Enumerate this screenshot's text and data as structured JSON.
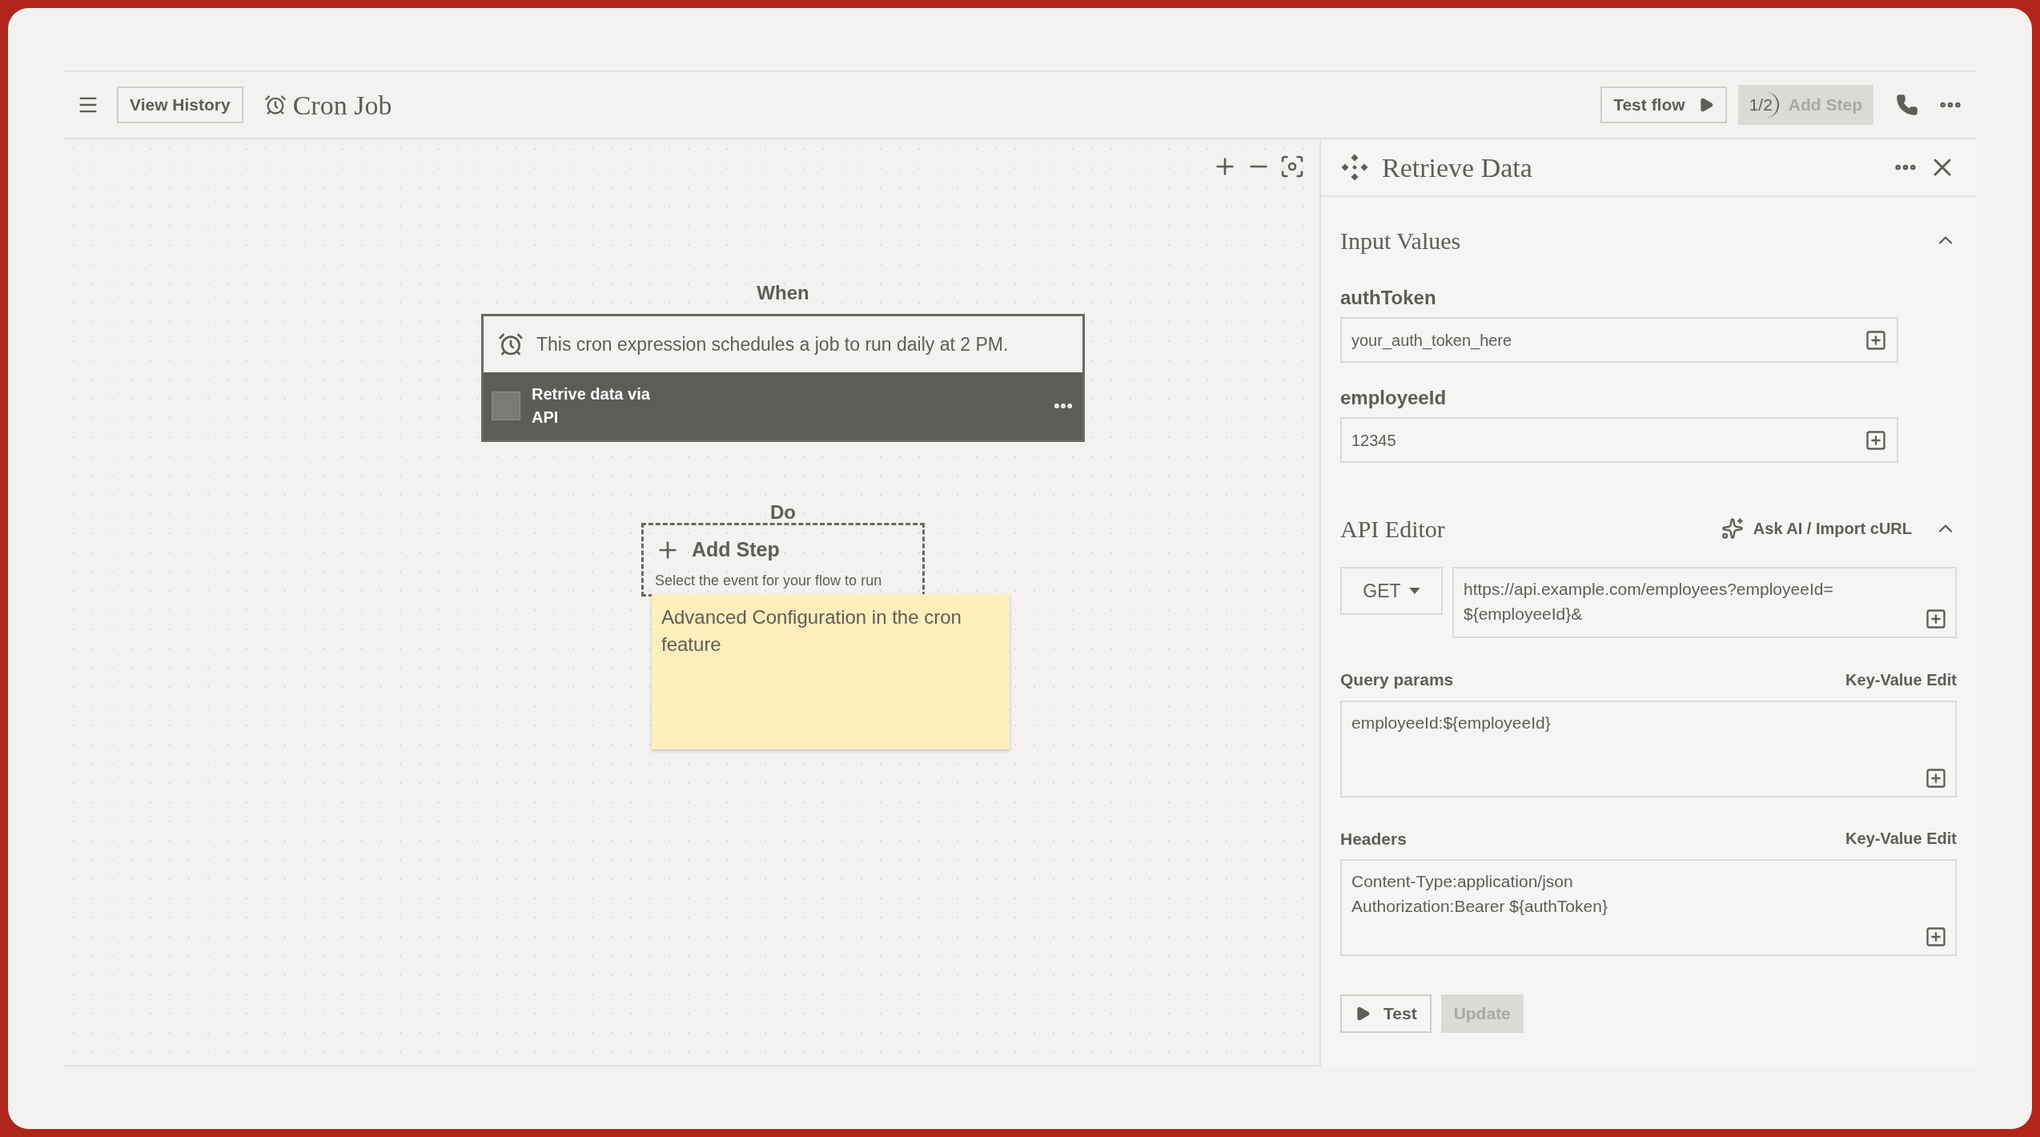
{
  "toolbar": {
    "history_button": "View History",
    "title": "Cron Job",
    "test_button": "Test flow",
    "step_counter": "1/2",
    "add_step_button": {
      "label": "Add Step",
      "disabled": true
    }
  },
  "canvas": {
    "trigger": {
      "section_label": "When",
      "description": "This cron expression schedules a job to run daily at 2 PM.",
      "step_title": "Retrive data via API"
    },
    "action": {
      "section_label": "Do",
      "add_step": "Add Step",
      "hint": "Select the event for your flow to run"
    },
    "note": "Advanced Configuration in the cron feature"
  },
  "panel": {
    "title": "Retrieve Data",
    "input_values": {
      "title": "Input Values",
      "expanded": true,
      "fields": [
        {
          "label": "authToken",
          "value": "your_auth_token_here"
        },
        {
          "label": "employeeId",
          "value": "12345"
        }
      ]
    },
    "api_editor": {
      "title": "API Editor",
      "expanded": true,
      "ai_link": "Ask AI / Import cURL",
      "method": "GET",
      "url_lines": [
        "https://api.example.com/employees?employeeId=",
        "${employeeId}&"
      ],
      "blocks": [
        {
          "label": "Query params",
          "edit_link": "Key-Value Edit",
          "lines": [
            "employeeId:${employeeId}"
          ]
        },
        {
          "label": "Headers",
          "edit_link": "Key-Value Edit",
          "lines": [
            "Content-Type:application/json",
            "Authorization:Bearer ${authToken}"
          ]
        }
      ]
    },
    "buttons": [
      {
        "kind": "run",
        "label": "Test",
        "disabled": false
      },
      {
        "kind": "plain",
        "label": "Update",
        "disabled": true
      }
    ]
  }
}
